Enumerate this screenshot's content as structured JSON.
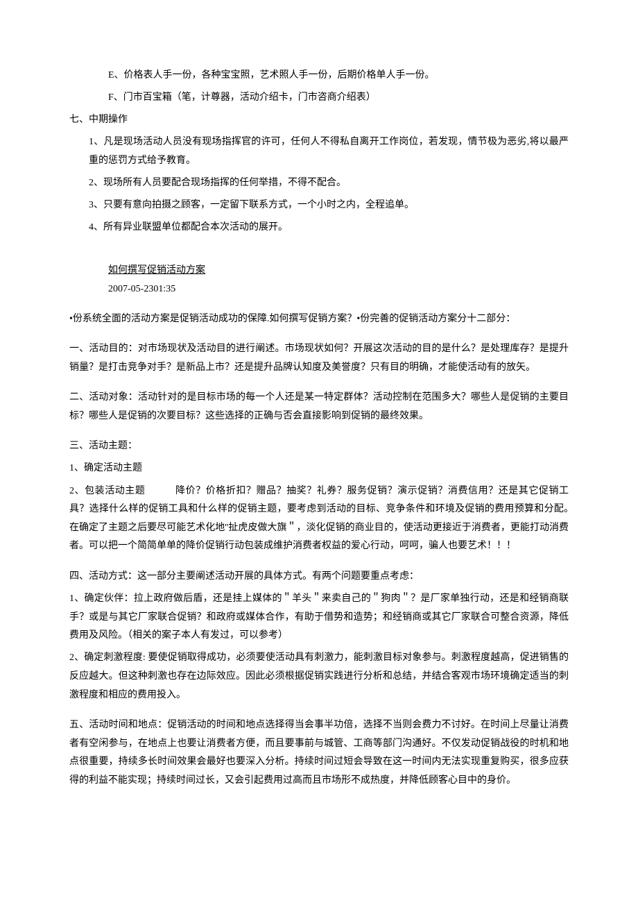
{
  "top": {
    "e": "E、价格表人手一份，各种宝宝照，艺术照人手一份，后期价格单人手一份。",
    "f": "F、门市百宝箱（笔，计尊器，活动介绍卡，门市咨商介绍表）"
  },
  "seven": {
    "title": "七、中期操作",
    "items": [
      "1、凡是现场活动人员没有现场指挥官的许可，任何人不得私自离开工作岗位，若发现，情节极为恶劣,将以最严重的惩罚方式给予教育。",
      "2、现场所有人员要配合现场指挥的任何举措，不得不配合。",
      "3、只要有意向拍摄之顾客，一定留下联系方式，一个小时之内，全程追单。",
      "4、所有异业联盟单位都配合本次活动的展开。"
    ]
  },
  "article": {
    "title": "如何撰写促销活动方案",
    "timestamp": "2007-05-2301:35",
    "intro": "•份系统全面的活动方案是促销活动成功的保障.如何撰写促销方案？•份完善的促销活动方案分十二部分：",
    "s1": "一、活动目的：对市场现状及活动目的进行阐述。市场现状如何？开展这次活动的目的是什么？是处理库存？是提升销量？是打击竞争对手？是新品上市？还是提升品牌认知度及美誉度？只有目的明确，才能使活动有的放矢。",
    "s2": "二、活动对象：活动针对的是目标市场的每一个人还是某一特定群体？活动控制在范围多大？哪些人是促销的主要目标？哪些人是促销的次要目标？这些选择的正确与否会直接影响到促销的最终效果。",
    "s3h": "三、活动主题：",
    "s3_1": "1、确定活动主题",
    "s3_2": "2、包装活动主题　　　降价？价格折扣？赠品？抽奖？礼券？服务促销？演示促销？消费信用？还是其它促销工具？选择什么样的促销工具和什么样的促销主题，要考虑到活动的目标、竞争条件和环境及促销的费用预算和分配。　　　　　　在确定了主题之后要尽可能艺术化地''扯虎皮做大旗＂，淡化促销的商业目的，使活动更接近于消费者，更能打动消费者。可以把一个简简单单的降价促销行动包装成维护消费者权益的爱心行动，呵呵，骗人也要艺术！！！",
    "s4h": "四、活动方式：这一部分主要阐述活动开展的具体方式。有两个问题要重点考虑：",
    "s4_1": "1、确定伙伴：拉上政府做后盾，还是挂上媒体的＂羊头＂来卖自己的＂狗肉＂？是厂家单独行动，还是和经销商联手？或是与其它厂家联合促销？和政府或媒体合作，有助于借势和造势；和经销商或其它厂家联合可整合资源，降低费用及风险。（相关的案子本人有发过，可以参考）",
    "s4_2": "2、确定刺激程度: 要使促销取得成功，必须要使活动具有刺激力，能刺激目标对象参与。刺激程度越高，促进销售的反应越大。但这种刺激也存在边际效应。因此必须根据促销实践进行分析和总结，并结合客观市场环境确定适当的刺激程度和相应的费用投入。",
    "s5": "五、活动时间和地点：促销活动的时间和地点选择得当会事半功倍，选择不当则会费力不讨好。在时间上尽量让消费者有空闲参与，在地点上也要让消费者方便，而且要事前与城管、工商等部门沟通好。不仅发动促销战役的时机和地点很重要，持续多长时间效果会最好也要深入分析。持续时间过短会导致在这一时间内无法实现重复购买，很多应获得的利益不能实现；持续时间过长，又会引起费用过高而且市场形不成热度，并降低顾客心目中的身价。"
  }
}
